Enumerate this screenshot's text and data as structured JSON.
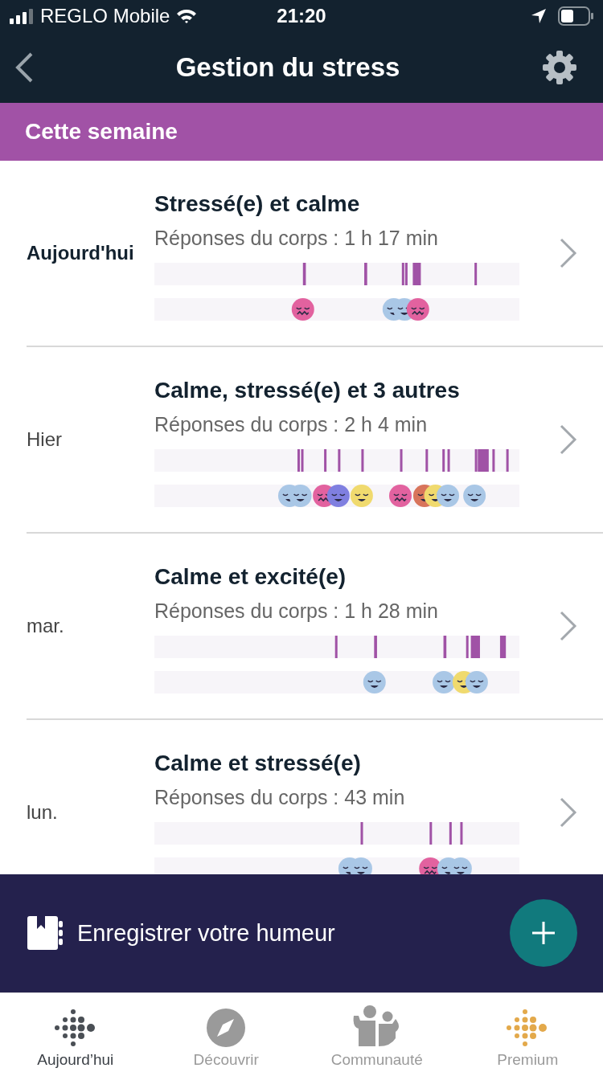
{
  "status_bar": {
    "carrier": "REGLO Mobile",
    "time": "21:20"
  },
  "header": {
    "title": "Gestion du stress"
  },
  "section": {
    "title": "Cette semaine"
  },
  "days": [
    {
      "day": "Aujourd'hui",
      "current": true,
      "title": "Stressé(e) et calme",
      "responses": "Réponses du corps : 1 h 17 min"
    },
    {
      "day": "Hier",
      "current": false,
      "title": "Calme, stressé(e) et 3 autres",
      "responses": "Réponses du corps : 2 h 4 min"
    },
    {
      "day": "mar.",
      "current": false,
      "title": "Calme et excité(e)",
      "responses": "Réponses du corps : 1 h 28 min"
    },
    {
      "day": "lun.",
      "current": false,
      "title": "Calme et stressé(e)",
      "responses": "Réponses du corps : 43 min"
    }
  ],
  "mood_bar": {
    "label": "Enregistrer votre humeur"
  },
  "tabs": [
    {
      "label": "Aujourd’hui",
      "kind": "today",
      "selected": true
    },
    {
      "label": "Découvrir",
      "kind": "discover",
      "selected": false
    },
    {
      "label": "Communauté",
      "kind": "community",
      "selected": false
    },
    {
      "label": "Premium",
      "kind": "premium",
      "selected": false
    }
  ]
}
